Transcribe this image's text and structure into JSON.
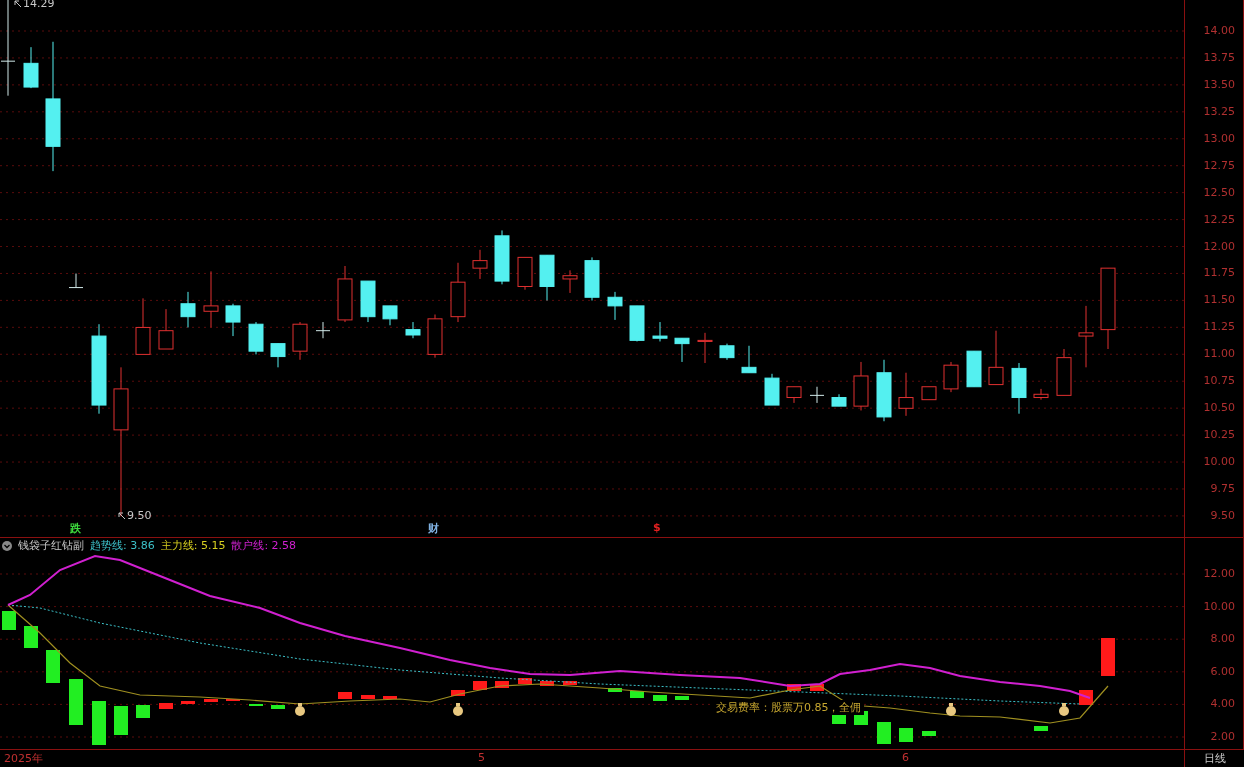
{
  "main_chart": {
    "high_marker": "14.29",
    "low_marker": "9.50",
    "events": [
      {
        "label": "跌",
        "color": "#3ddc3d"
      },
      {
        "label": "财",
        "color": "#7fb0e0"
      },
      {
        "label": "$",
        "color": "#e02020"
      }
    ],
    "price_axis": [
      "14.00",
      "13.75",
      "13.50",
      "13.25",
      "13.00",
      "12.75",
      "12.50",
      "12.25",
      "12.00",
      "11.75",
      "11.50",
      "11.25",
      "11.00",
      "10.75",
      "10.50",
      "10.25",
      "10.00",
      "9.75",
      "9.50"
    ]
  },
  "indicator": {
    "name": "钱袋子红钻副",
    "values": [
      {
        "label": "趋势线: 3.86",
        "color": "#3cc0c8"
      },
      {
        "label": "主力线: 5.15",
        "color": "#d8d020"
      },
      {
        "label": "散户线: 2.58",
        "color": "#d020d0"
      }
    ],
    "note": "交易费率：股票万0.85，全佣",
    "axis": [
      "12.00",
      "10.00",
      "8.00",
      "6.00",
      "4.00",
      "2.00"
    ]
  },
  "time_axis": {
    "labels": [
      "2025年",
      "5",
      "6"
    ],
    "period": "日线"
  }
}
